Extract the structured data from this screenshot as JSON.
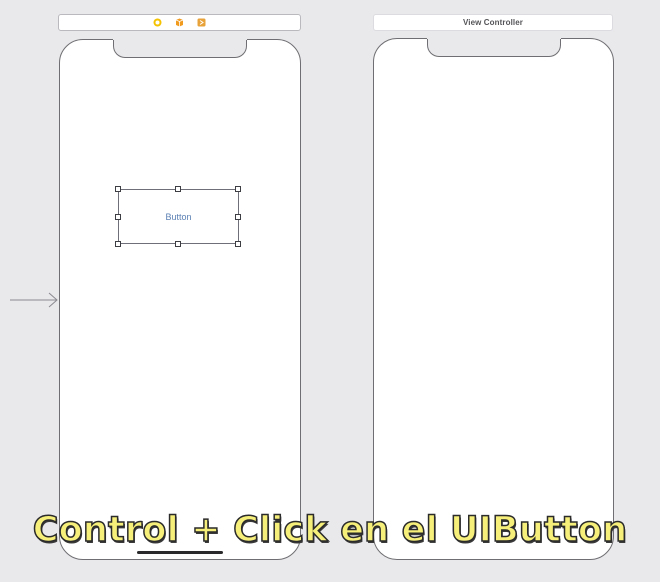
{
  "scenes": {
    "left": {
      "dock_icons": [
        "view-controller-icon",
        "first-responder-icon",
        "exit-icon"
      ],
      "button": {
        "label": "Button"
      }
    },
    "right": {
      "dock_title": "View Controller"
    }
  },
  "caption": "Control + Click en el UIButton",
  "colors": {
    "canvas": "#e9e9ec",
    "caption_fill": "#f6ef7a",
    "caption_outline": "#2b2b2b",
    "button_text": "#5a7fb3",
    "dock_icon_vc": "#f5c200",
    "dock_icon_responder": "#f09a1e",
    "dock_icon_exit": "#e8a23a"
  }
}
